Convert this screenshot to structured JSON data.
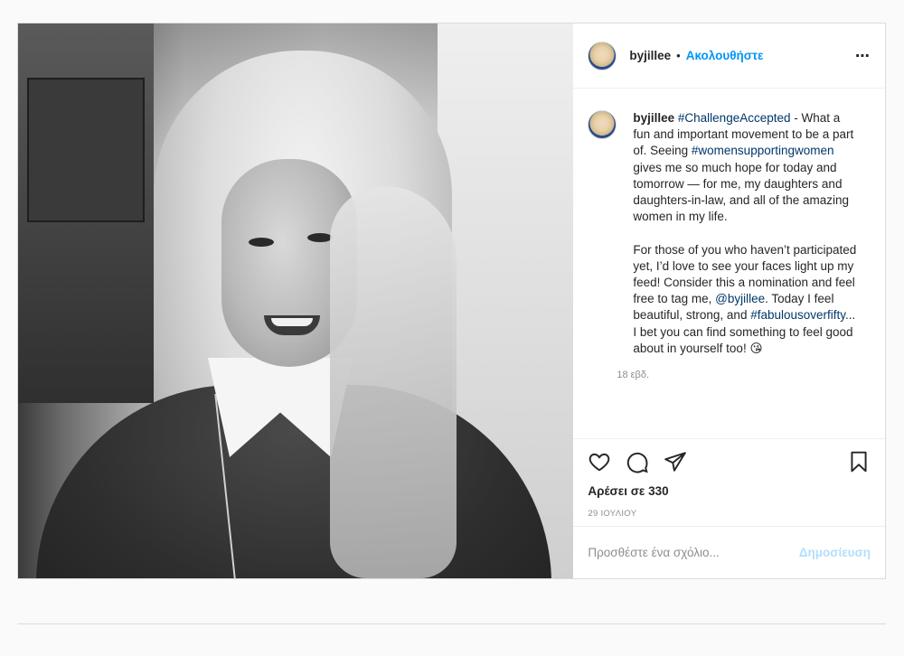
{
  "post": {
    "username": "byjillee",
    "separator": "•",
    "follow_label": "Ακολουθήστε",
    "more_icon": "⋯",
    "caption": {
      "author": "byjillee",
      "parts": [
        {
          "type": "tag",
          "text": "#ChallengeAccepted"
        },
        {
          "type": "text",
          "text": " - What a fun and important movement to be a part of. Seeing "
        },
        {
          "type": "tag",
          "text": "#womensupportingwomen"
        },
        {
          "type": "text",
          "text": " gives me so much hope for today and tomorrow — for me, my daughters and daughters-in-law, and all of the amazing women in my life."
        },
        {
          "type": "break"
        },
        {
          "type": "text",
          "text": "For those of you who haven’t participated yet, I’d love to see your faces light up my feed! Consider this a nomination and feel free to tag me, "
        },
        {
          "type": "tag",
          "text": "@byjillee"
        },
        {
          "type": "text",
          "text": ". Today I feel beautiful, strong, and "
        },
        {
          "type": "tag",
          "text": "#fabulousoverfifty"
        },
        {
          "type": "text",
          "text": "... I bet you can find something to feel good about in yourself too! 😘"
        }
      ],
      "time_ago": "18 εβδ."
    },
    "likes_label": "Αρέσει σε 330",
    "date_label": "29 ΙΟΥΛΙΟΥ",
    "comment_placeholder": "Προσθέστε ένα σχόλιο...",
    "post_button": "Δημοσίευση",
    "icons": {
      "like": "heart-icon",
      "comment": "comment-icon",
      "share": "share-icon",
      "save": "bookmark-icon"
    },
    "colors": {
      "follow": "#0095f6",
      "tag": "#00376b",
      "post_button_disabled": "#b2dffc"
    }
  }
}
